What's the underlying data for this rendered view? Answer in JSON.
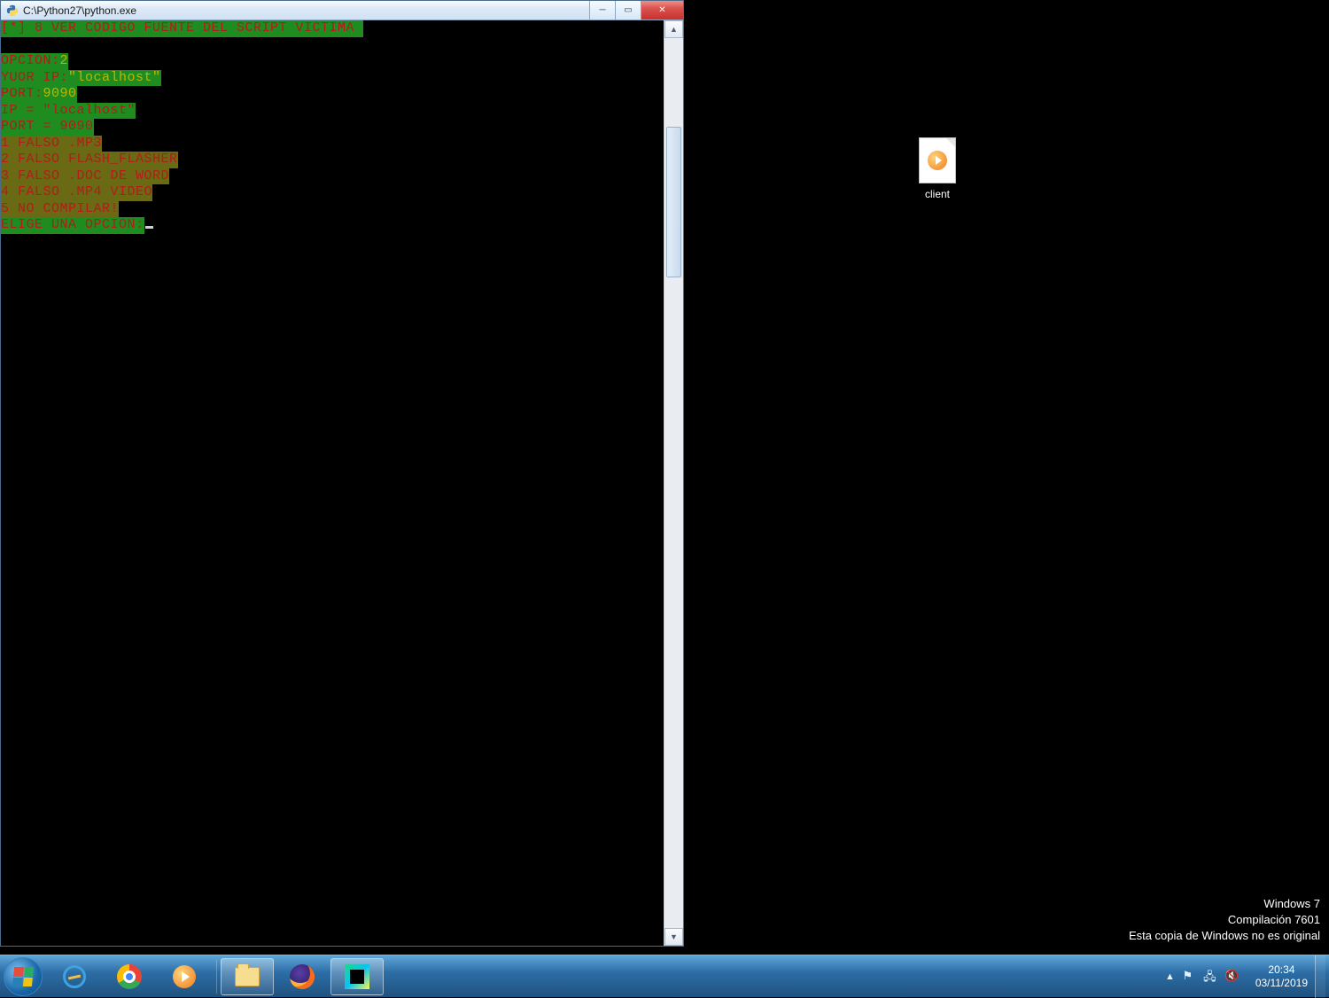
{
  "window": {
    "title": "C:\\Python27\\python.exe"
  },
  "console": {
    "line_header": "[*] 8 VER CODIGO FUENTE DEL SCRIPT VICTIMA ",
    "opcion_prompt": "OPCION:",
    "opcion_value": "2",
    "ip_prompt": "YUOR IP:",
    "ip_value": "\"localhost\"",
    "port_prompt": "PORT:",
    "port_value": "9090",
    "ip_echo": "IP = \"localhost\"",
    "port_echo": "PORT = 9090",
    "menu": [
      "1 FALSO .MP3",
      "2 FALSO FLASH_FLASHER",
      "3 FALSO .DOC DE WORD",
      "4 FALSO .MP4 VIDEO",
      "5 NO COMPILAR!"
    ],
    "elige": "ELIGE UNA OPCION:"
  },
  "desktop": {
    "icon_label": "client"
  },
  "watermark": {
    "line1": "Windows 7",
    "line2": "Compilación  7601",
    "line3": "Esta copia de Windows no es original"
  },
  "tray": {
    "time": "20:34",
    "date": "03/11/2019"
  }
}
